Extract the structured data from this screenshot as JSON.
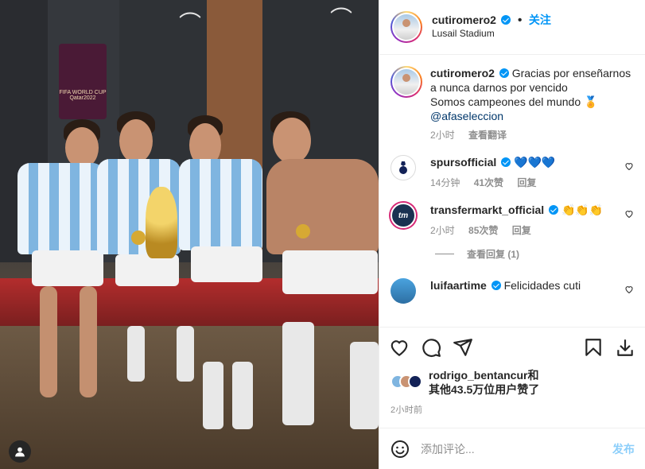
{
  "post": {
    "username": "cutiromero2",
    "verified": true,
    "follow_label": "关注",
    "location": "Lusail Stadium",
    "caption_line1": "Gracias por enseñarnos a nunca darnos por vencido",
    "caption_line2": "Somos campeones del mundo 🏅",
    "caption_mention": "@afaseleccion",
    "caption_time": "2小时",
    "translate_label": "查看翻译"
  },
  "comments": [
    {
      "username": "spursofficial",
      "text": "💙💙💙",
      "time": "14分钟",
      "likes": "41次赞",
      "reply": "回复",
      "avatar_icon": "spurs-logo-icon"
    },
    {
      "username": "transfermarkt_official",
      "text": "👏👏👏",
      "time": "2小时",
      "likes": "85次赞",
      "reply": "回复",
      "avatar_icon": "tm-logo-icon",
      "avatar_text": "tm"
    },
    {
      "username": "luifaartime",
      "text": "Felicidades cuti"
    }
  ],
  "view_replies": "查看回复 (1)",
  "likes": {
    "user": "rodrigo_bentancur",
    "joiner": "和",
    "others": "其他43.5万位用户赞了"
  },
  "timestamp": "2小时前",
  "add_comment": {
    "placeholder": "添加评论...",
    "post_label": "发布"
  },
  "photo": {
    "wc_logo_text": "FIFA WORLD CUP Qatar2022"
  },
  "colors": {
    "accent": "#0095f6",
    "muted": "#8e8e8e",
    "text": "#262626"
  }
}
